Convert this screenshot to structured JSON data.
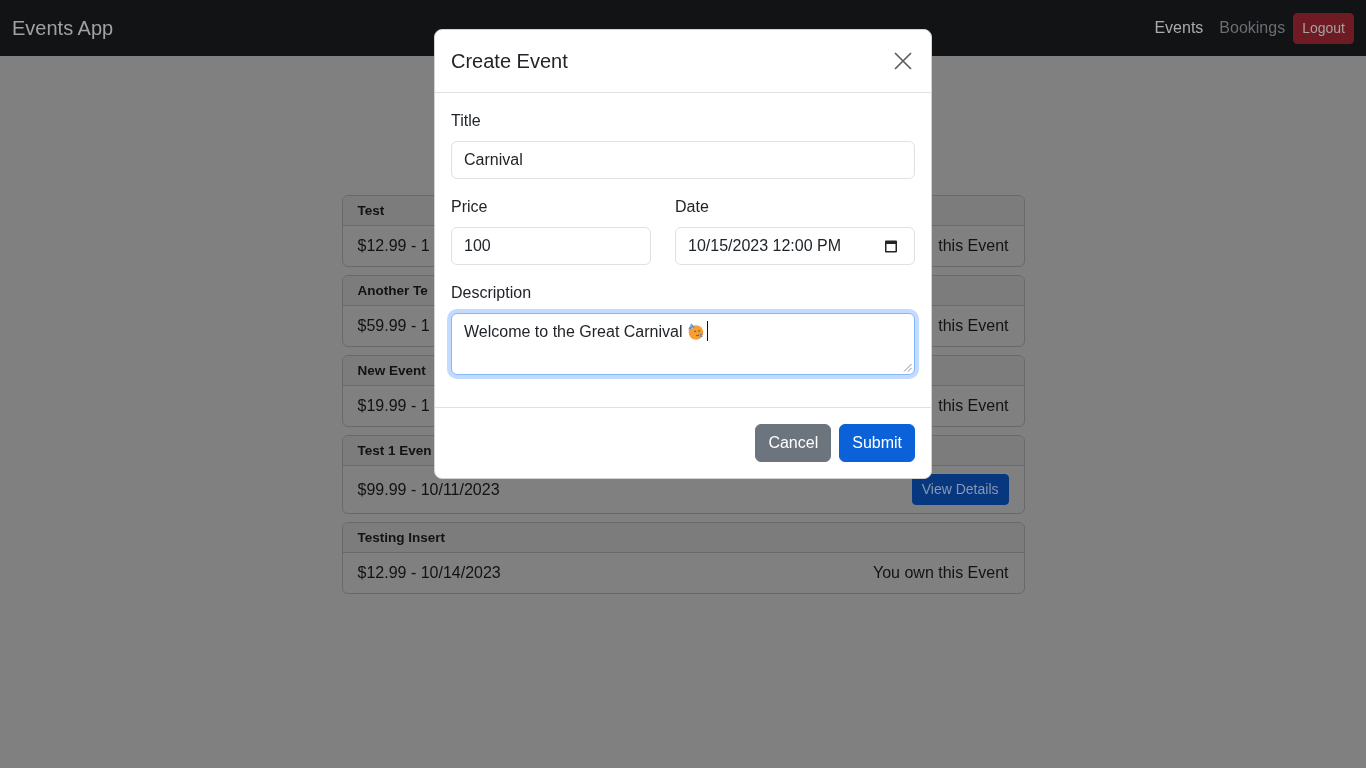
{
  "navbar": {
    "brand": "Events App",
    "links": [
      {
        "label": "Events",
        "selected": true
      },
      {
        "label": "Bookings",
        "selected": false
      }
    ],
    "logout_button": "Logout"
  },
  "events": [
    {
      "title": "Test",
      "details": "$12.99 - 1",
      "kind": "note",
      "status": "this Event"
    },
    {
      "title": "Another Te",
      "details": "$59.99 - 1",
      "kind": "note",
      "status": "this Event"
    },
    {
      "title": "New Event",
      "details": "$19.99 - 1",
      "kind": "note",
      "status": "this Event"
    },
    {
      "title": "Test 1 Even",
      "details": "$99.99 - 10/11/2023",
      "kind": "button",
      "action": "View Details"
    },
    {
      "title": "Testing Insert",
      "details": "$12.99 - 10/14/2023",
      "kind": "note",
      "status": "You own this Event"
    }
  ],
  "modal": {
    "title": "Create Event",
    "form": {
      "title": {
        "label": "Title",
        "value": "Carnival"
      },
      "price": {
        "label": "Price",
        "value": "100"
      },
      "date": {
        "label": "Date",
        "value": "10/15/2023 12:00 PM"
      },
      "description": {
        "label": "Description",
        "value": "Welcome to the Great Carnival",
        "focused": true
      }
    },
    "buttons": [
      {
        "label": "Cancel",
        "kind": "secondary"
      },
      {
        "label": "Submit",
        "kind": "primary"
      }
    ]
  }
}
